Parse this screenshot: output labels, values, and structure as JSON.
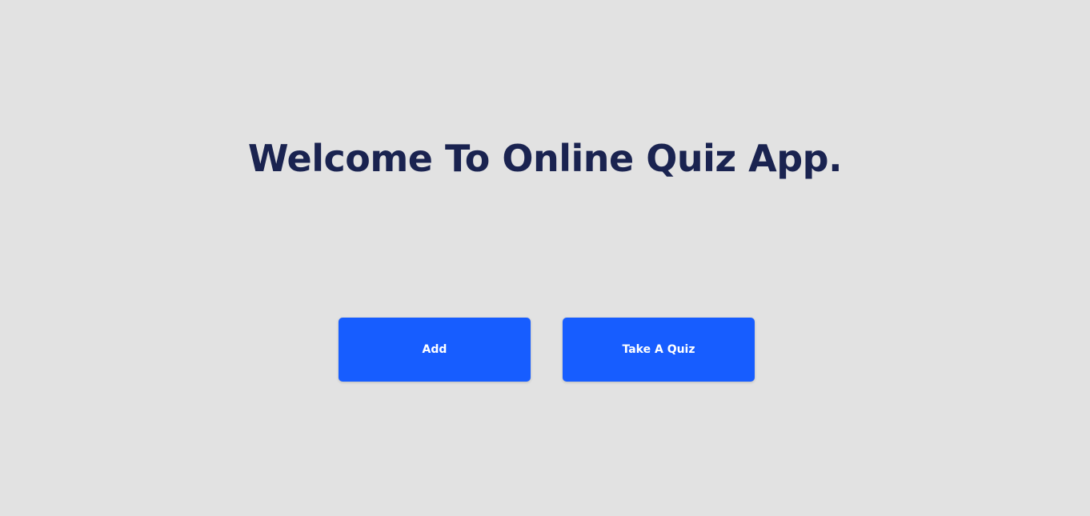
{
  "page": {
    "title": "Welcome To Online Quiz App.",
    "background_color": "#e2e2e2",
    "title_color": "#1a2350"
  },
  "actions": {
    "add_label": "Add",
    "take_quiz_label": "Take A Quiz",
    "button_color": "#175dff"
  }
}
